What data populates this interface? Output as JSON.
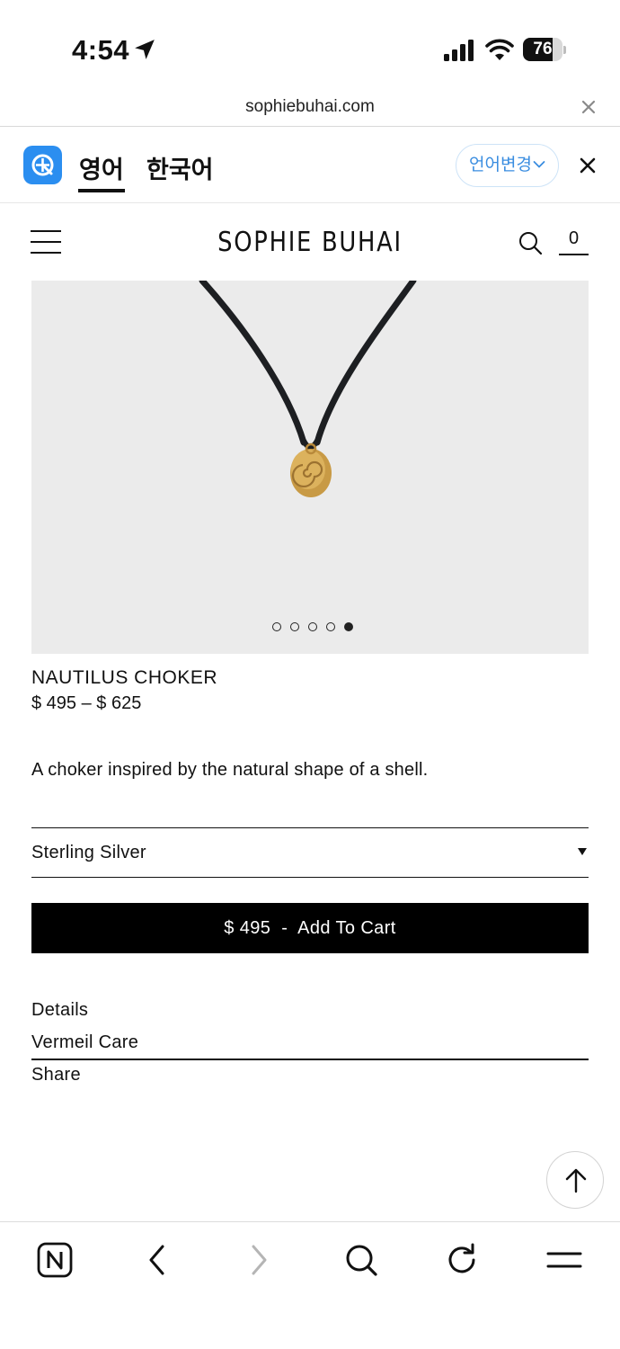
{
  "status_bar": {
    "time": "4:54",
    "battery": "76",
    "battery_level_pct": 76
  },
  "browser": {
    "url": "sophiebuhai.com",
    "translate": {
      "source_language": "영어",
      "target_language": "한국어",
      "change_language_label": "언어변경"
    }
  },
  "site": {
    "brand": "SOPHIE BUHAI",
    "cart_count": "0"
  },
  "product": {
    "gallery": {
      "slide_count": 5,
      "active_slide": 5
    },
    "title": "NAUTILUS CHOKER",
    "price_range": "$ 495 – $ 625",
    "description": "A choker inspired by the natural shape of a shell.",
    "material_selected": "Sterling Silver",
    "add_to_cart_label": "$ 495  -  Add To Cart",
    "links": [
      "Details",
      "Vermeil Care",
      "Share"
    ]
  },
  "icons": {
    "location": "location-arrow-icon",
    "signal": "cellular-signal-icon",
    "wifi": "wifi-icon",
    "translate": "translate-app-icon",
    "menu": "hamburger-menu-icon",
    "search": "search-icon",
    "scroll_top": "arrow-up-icon",
    "toolbar": [
      "naver-home-icon",
      "back-icon",
      "forward-icon",
      "search-icon",
      "reload-icon",
      "menu-icon"
    ]
  },
  "colors": {
    "accent_blue": "#2b8ef0",
    "cart_button": "#000000",
    "image_bg": "#ebebeb"
  }
}
